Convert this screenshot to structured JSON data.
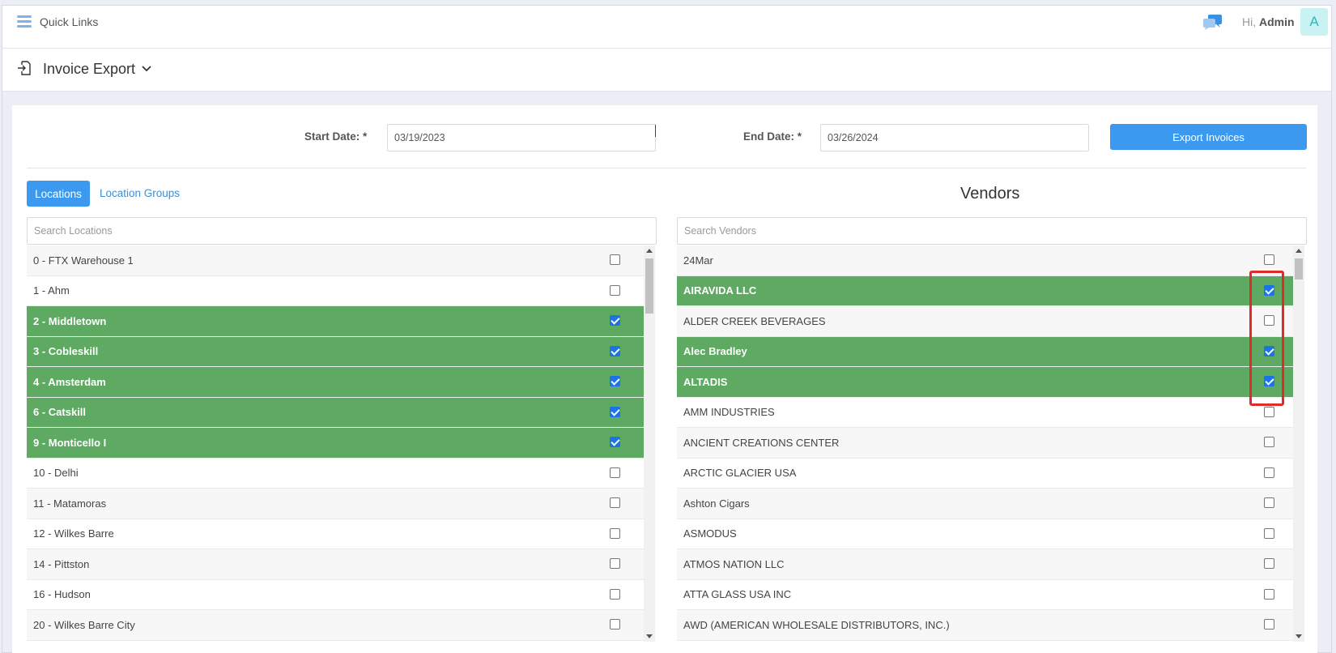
{
  "topbar": {
    "quick_links": "Quick Links",
    "greeting_prefix": "Hi,",
    "user_name": "Admin",
    "avatar_letter": "A"
  },
  "header": {
    "title": "Invoice Export"
  },
  "form": {
    "start_label": "Start Date: *",
    "start_value": "03/19/2023",
    "end_label": "End Date: *",
    "end_value": "03/26/2024",
    "export_button": "Export Invoices"
  },
  "tabs": {
    "locations": "Locations",
    "location_groups": "Location Groups"
  },
  "locations": {
    "search_placeholder": "Search Locations",
    "items": [
      {
        "label": "0 - FTX Warehouse 1",
        "checked": false
      },
      {
        "label": "1 - Ahm",
        "checked": false
      },
      {
        "label": "2 - Middletown",
        "checked": true
      },
      {
        "label": "3 - Cobleskill",
        "checked": true
      },
      {
        "label": "4 - Amsterdam",
        "checked": true
      },
      {
        "label": "6 - Catskill",
        "checked": true
      },
      {
        "label": "9 - Monticello I",
        "checked": true
      },
      {
        "label": "10 - Delhi",
        "checked": false
      },
      {
        "label": "11 - Matamoras",
        "checked": false
      },
      {
        "label": "12 - Wilkes Barre",
        "checked": false
      },
      {
        "label": "14 - Pittston",
        "checked": false
      },
      {
        "label": "16 - Hudson",
        "checked": false
      },
      {
        "label": "20 - Wilkes Barre City",
        "checked": false
      }
    ]
  },
  "vendors": {
    "title": "Vendors",
    "search_placeholder": "Search Vendors",
    "items": [
      {
        "label": "24Mar",
        "checked": false
      },
      {
        "label": "AIRAVIDA LLC",
        "checked": true
      },
      {
        "label": "ALDER CREEK BEVERAGES",
        "checked": false
      },
      {
        "label": "Alec Bradley",
        "checked": true
      },
      {
        "label": "ALTADIS",
        "checked": true
      },
      {
        "label": "AMM INDUSTRIES",
        "checked": false
      },
      {
        "label": "ANCIENT CREATIONS CENTER",
        "checked": false
      },
      {
        "label": "ARCTIC GLACIER USA",
        "checked": false
      },
      {
        "label": "Ashton Cigars",
        "checked": false
      },
      {
        "label": "ASMODUS",
        "checked": false
      },
      {
        "label": "ATMOS NATION LLC",
        "checked": false
      },
      {
        "label": "ATTA GLASS USA INC",
        "checked": false
      },
      {
        "label": "AWD (AMERICAN WHOLESALE DISTRIBUTORS, INC.)",
        "checked": false
      }
    ]
  },
  "colors": {
    "primary": "#3b9af0",
    "selected_row": "#5faa63",
    "highlight": "#e02b2b"
  }
}
